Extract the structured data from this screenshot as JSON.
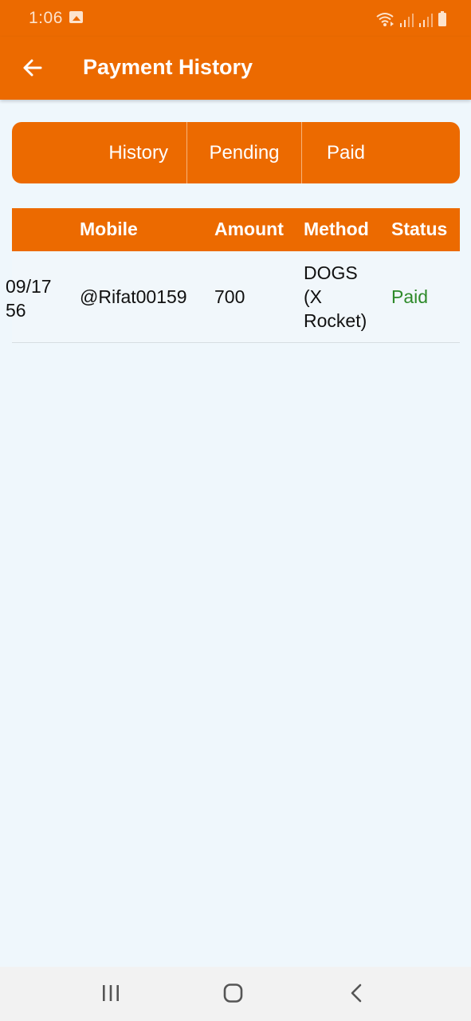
{
  "status_bar": {
    "time": "1:06",
    "icons": [
      "image-icon",
      "wifi-icon",
      "signal-icon",
      "signal-icon",
      "battery-icon"
    ]
  },
  "app_bar": {
    "title": "Payment History",
    "back_icon": "arrow-left-icon"
  },
  "tabs": [
    {
      "label": "History"
    },
    {
      "label": "Pending"
    },
    {
      "label": "Paid"
    }
  ],
  "table": {
    "columns": [
      "Mobile",
      "Amount",
      "Method",
      "Status"
    ],
    "rows": [
      {
        "date_line1": "09/17",
        "date_line2": "56",
        "mobile": "@Rifat00159",
        "amount": "700",
        "method_line1": "DOGS",
        "method_line2": "(X",
        "method_line3": "Rocket)",
        "status": "Paid"
      }
    ]
  },
  "nav_bar": {
    "icons": [
      "recent-apps-icon",
      "home-icon",
      "back-icon"
    ]
  },
  "colors": {
    "primary": "#ec6a00",
    "background": "#eff7fc",
    "status_paid": "#2e8a2a"
  }
}
